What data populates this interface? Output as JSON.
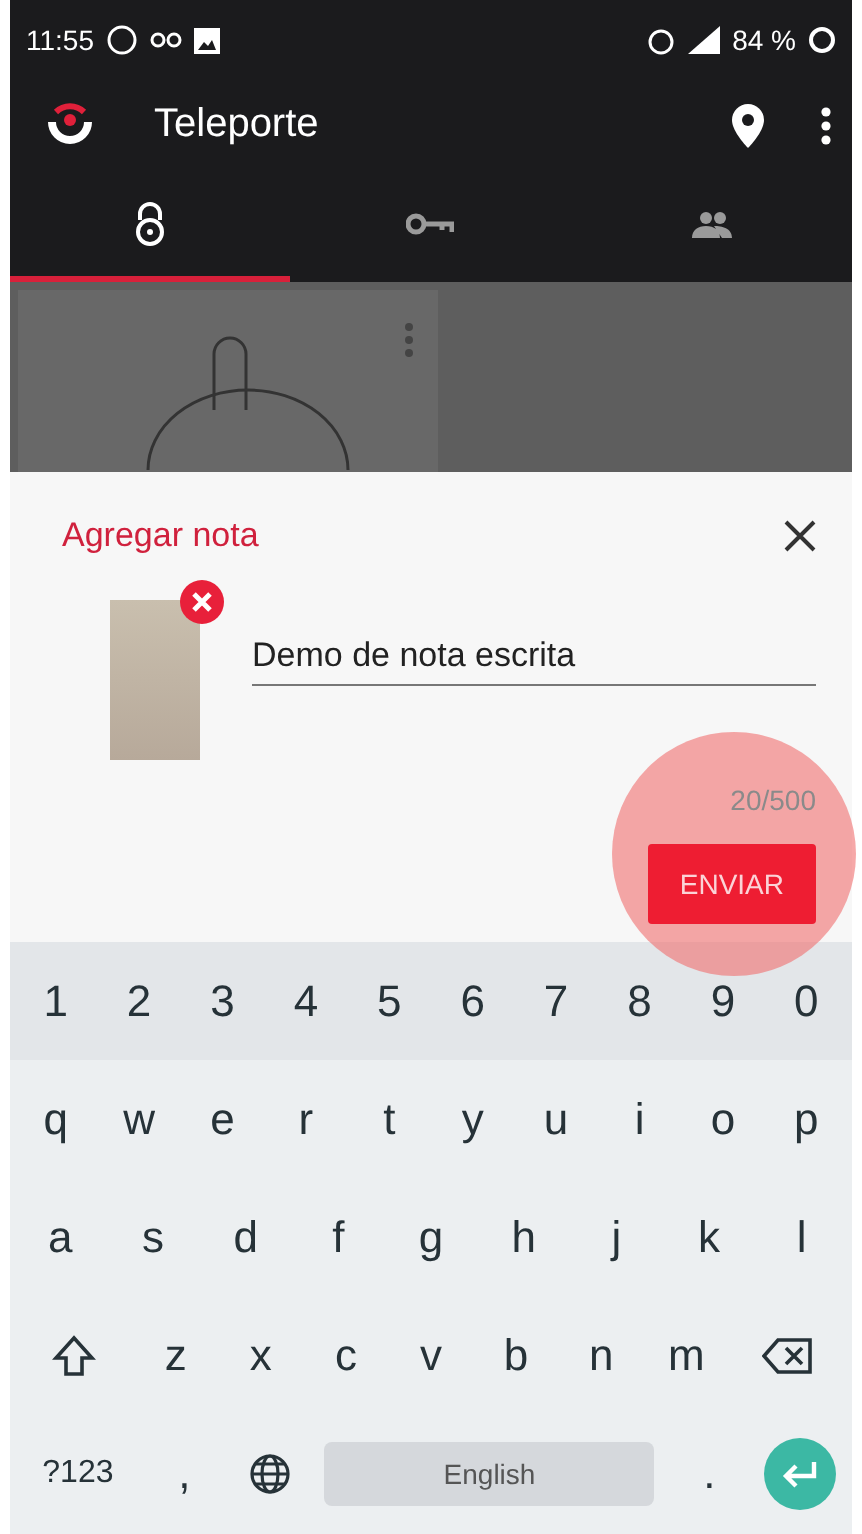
{
  "status_bar": {
    "time": "11:55",
    "battery": "84 %"
  },
  "app_bar": {
    "title": "Teleporte"
  },
  "tabs": [
    {
      "selected": true
    },
    {
      "selected": false
    },
    {
      "selected": false
    }
  ],
  "note_sheet": {
    "title": "Agregar nota",
    "value": "Demo de nota escrita",
    "counter": "20/500",
    "send_button": "ENVIAR"
  },
  "keyboard": {
    "rows": [
      {
        "keys": [
          {
            "kind": "char",
            "label": "1"
          },
          {
            "kind": "char",
            "label": "2"
          },
          {
            "kind": "char",
            "label": "3"
          },
          {
            "kind": "char",
            "label": "4"
          },
          {
            "kind": "char",
            "label": "5"
          },
          {
            "kind": "char",
            "label": "6"
          },
          {
            "kind": "char",
            "label": "7"
          },
          {
            "kind": "char",
            "label": "8"
          },
          {
            "kind": "char",
            "label": "9"
          },
          {
            "kind": "char",
            "label": "0"
          }
        ]
      },
      {
        "keys": [
          {
            "kind": "char",
            "label": "q"
          },
          {
            "kind": "char",
            "label": "w"
          },
          {
            "kind": "char",
            "label": "e"
          },
          {
            "kind": "char",
            "label": "r"
          },
          {
            "kind": "char",
            "label": "t"
          },
          {
            "kind": "char",
            "label": "y"
          },
          {
            "kind": "char",
            "label": "u"
          },
          {
            "kind": "char",
            "label": "i"
          },
          {
            "kind": "char",
            "label": "o"
          },
          {
            "kind": "char",
            "label": "p"
          }
        ]
      },
      {
        "keys": [
          {
            "kind": "char",
            "label": "a"
          },
          {
            "kind": "char",
            "label": "s"
          },
          {
            "kind": "char",
            "label": "d"
          },
          {
            "kind": "char",
            "label": "f"
          },
          {
            "kind": "char",
            "label": "g"
          },
          {
            "kind": "char",
            "label": "h"
          },
          {
            "kind": "char",
            "label": "j"
          },
          {
            "kind": "char",
            "label": "k"
          },
          {
            "kind": "char",
            "label": "l"
          }
        ]
      },
      {
        "keys": [
          {
            "kind": "shift"
          },
          {
            "kind": "char",
            "label": "z"
          },
          {
            "kind": "char",
            "label": "x"
          },
          {
            "kind": "char",
            "label": "c"
          },
          {
            "kind": "char",
            "label": "v"
          },
          {
            "kind": "char",
            "label": "b"
          },
          {
            "kind": "char",
            "label": "n"
          },
          {
            "kind": "char",
            "label": "m"
          },
          {
            "kind": "backspace"
          }
        ]
      },
      {
        "keys": [
          {
            "kind": "symbols",
            "label": "?123"
          },
          {
            "kind": "char",
            "label": ","
          },
          {
            "kind": "globe"
          },
          {
            "kind": "space",
            "label": "English"
          },
          {
            "kind": "char",
            "label": "."
          },
          {
            "kind": "enter"
          }
        ]
      }
    ]
  }
}
